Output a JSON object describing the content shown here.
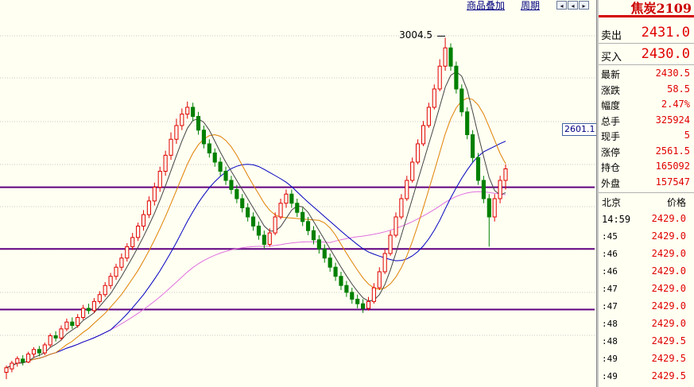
{
  "toolbar": {
    "overlay": "商品叠加",
    "period": "周期"
  },
  "symbol": "焦炭2109",
  "quote": {
    "sell_label": "卖出",
    "sell": "2431.0",
    "buy_label": "买入",
    "buy": "2430.0",
    "stats": [
      {
        "label": "最新",
        "value": "2430.5"
      },
      {
        "label": "涨跌",
        "value": "58.5"
      },
      {
        "label": "幅度",
        "value": "2.47%"
      },
      {
        "label": "总手",
        "value": "325924"
      },
      {
        "label": "现手",
        "value": "5"
      },
      {
        "label": "涨停",
        "value": "2561.5"
      },
      {
        "label": "持仓",
        "value": "165092"
      },
      {
        "label": "外盘",
        "value": "157547"
      }
    ]
  },
  "ticks_header": {
    "time": "北京",
    "price": "价格"
  },
  "ticks": [
    {
      "time": "14:59",
      "price": "2429.0"
    },
    {
      "time": ":45",
      "price": "2429.0"
    },
    {
      "time": ":46",
      "price": "2429.0"
    },
    {
      "time": ":46",
      "price": "2429.0"
    },
    {
      "time": ":47",
      "price": "2429.0"
    },
    {
      "time": ":47",
      "price": "2429.0"
    },
    {
      "time": ":48",
      "price": "2429.0"
    },
    {
      "time": ":48",
      "price": "2429.5"
    },
    {
      "time": ":49",
      "price": "2429.5"
    },
    {
      "time": ":49",
      "price": "2429.5"
    }
  ],
  "colors": {
    "up": "#e00000",
    "down": "#008000",
    "ma5": "#444444",
    "ma10": "#e08000",
    "ma20": "#0000c0",
    "ma60": "#e070e0",
    "hline": "#600080",
    "background": "#fffff2"
  },
  "chart_data": {
    "type": "candlestick",
    "ylim": [
      1500,
      3100
    ],
    "peak_annotation": "3004.5",
    "current_marker": "2601.1",
    "horizontal_levels": [
      2350,
      2080,
      1815
    ],
    "candles": [
      [
        1540,
        1560,
        1510,
        1570
      ],
      [
        1555,
        1580,
        1540,
        1590
      ],
      [
        1580,
        1600,
        1565,
        1610
      ],
      [
        1598,
        1585,
        1570,
        1615
      ],
      [
        1585,
        1620,
        1580,
        1630
      ],
      [
        1620,
        1640,
        1605,
        1650
      ],
      [
        1640,
        1625,
        1610,
        1655
      ],
      [
        1625,
        1660,
        1615,
        1670
      ],
      [
        1660,
        1700,
        1650,
        1710
      ],
      [
        1700,
        1690,
        1675,
        1720
      ],
      [
        1690,
        1730,
        1680,
        1745
      ],
      [
        1730,
        1760,
        1720,
        1775
      ],
      [
        1760,
        1745,
        1730,
        1780
      ],
      [
        1745,
        1780,
        1735,
        1795
      ],
      [
        1780,
        1820,
        1770,
        1835
      ],
      [
        1820,
        1810,
        1795,
        1840
      ],
      [
        1810,
        1850,
        1800,
        1865
      ],
      [
        1850,
        1880,
        1840,
        1895
      ],
      [
        1880,
        1920,
        1870,
        1935
      ],
      [
        1920,
        1960,
        1905,
        1975
      ],
      [
        1960,
        2000,
        1945,
        2015
      ],
      [
        2000,
        2040,
        1985,
        2060
      ],
      [
        2040,
        2090,
        2025,
        2105
      ],
      [
        2090,
        2130,
        2075,
        2150
      ],
      [
        2130,
        2180,
        2115,
        2195
      ],
      [
        2180,
        2230,
        2160,
        2250
      ],
      [
        2230,
        2290,
        2215,
        2310
      ],
      [
        2290,
        2350,
        2270,
        2370
      ],
      [
        2350,
        2420,
        2330,
        2440
      ],
      [
        2420,
        2490,
        2400,
        2510
      ],
      [
        2490,
        2560,
        2470,
        2590
      ],
      [
        2560,
        2620,
        2540,
        2650
      ],
      [
        2620,
        2670,
        2600,
        2695
      ],
      [
        2670,
        2700,
        2650,
        2725
      ],
      [
        2700,
        2660,
        2640,
        2720
      ],
      [
        2660,
        2600,
        2580,
        2680
      ],
      [
        2600,
        2540,
        2520,
        2620
      ],
      [
        2540,
        2500,
        2480,
        2560
      ],
      [
        2500,
        2460,
        2440,
        2520
      ],
      [
        2460,
        2420,
        2400,
        2480
      ],
      [
        2420,
        2380,
        2360,
        2440
      ],
      [
        2380,
        2340,
        2320,
        2400
      ],
      [
        2340,
        2300,
        2280,
        2360
      ],
      [
        2300,
        2260,
        2240,
        2320
      ],
      [
        2260,
        2220,
        2200,
        2280
      ],
      [
        2220,
        2180,
        2160,
        2240
      ],
      [
        2180,
        2140,
        2120,
        2200
      ],
      [
        2140,
        2100,
        2080,
        2160
      ],
      [
        2100,
        2150,
        2090,
        2170
      ],
      [
        2150,
        2220,
        2140,
        2240
      ],
      [
        2220,
        2280,
        2210,
        2300
      ],
      [
        2280,
        2320,
        2260,
        2340
      ],
      [
        2320,
        2280,
        2260,
        2340
      ],
      [
        2280,
        2240,
        2220,
        2300
      ],
      [
        2240,
        2200,
        2180,
        2260
      ],
      [
        2200,
        2160,
        2140,
        2220
      ],
      [
        2160,
        2120,
        2100,
        2180
      ],
      [
        2120,
        2080,
        2060,
        2140
      ],
      [
        2080,
        2040,
        2020,
        2100
      ],
      [
        2040,
        2000,
        1980,
        2060
      ],
      [
        2000,
        1960,
        1940,
        2020
      ],
      [
        1960,
        1920,
        1900,
        1980
      ],
      [
        1920,
        1890,
        1870,
        1940
      ],
      [
        1890,
        1860,
        1840,
        1910
      ],
      [
        1860,
        1840,
        1820,
        1880
      ],
      [
        1840,
        1820,
        1800,
        1860
      ],
      [
        1820,
        1850,
        1810,
        1870
      ],
      [
        1850,
        1910,
        1840,
        1930
      ],
      [
        1910,
        1980,
        1900,
        2000
      ],
      [
        1980,
        2060,
        1970,
        2080
      ],
      [
        2060,
        2140,
        2050,
        2160
      ],
      [
        2140,
        2220,
        2130,
        2240
      ],
      [
        2220,
        2300,
        2210,
        2320
      ],
      [
        2300,
        2380,
        2290,
        2400
      ],
      [
        2380,
        2460,
        2370,
        2480
      ],
      [
        2460,
        2540,
        2450,
        2560
      ],
      [
        2540,
        2620,
        2530,
        2640
      ],
      [
        2620,
        2700,
        2610,
        2720
      ],
      [
        2700,
        2780,
        2690,
        2800
      ],
      [
        2780,
        2880,
        2770,
        2910
      ],
      [
        2880,
        2960,
        2860,
        3004.5
      ],
      [
        2960,
        2880,
        2860,
        2980
      ],
      [
        2880,
        2780,
        2760,
        2900
      ],
      [
        2780,
        2680,
        2660,
        2800
      ],
      [
        2680,
        2580,
        2560,
        2700
      ],
      [
        2580,
        2480,
        2460,
        2600
      ],
      [
        2480,
        2380,
        2360,
        2500
      ],
      [
        2380,
        2300,
        2280,
        2400
      ],
      [
        2300,
        2220,
        2090,
        2320
      ],
      [
        2220,
        2300,
        2200,
        2320
      ],
      [
        2300,
        2380,
        2280,
        2400
      ],
      [
        2380,
        2430.5,
        2340,
        2450
      ]
    ]
  }
}
